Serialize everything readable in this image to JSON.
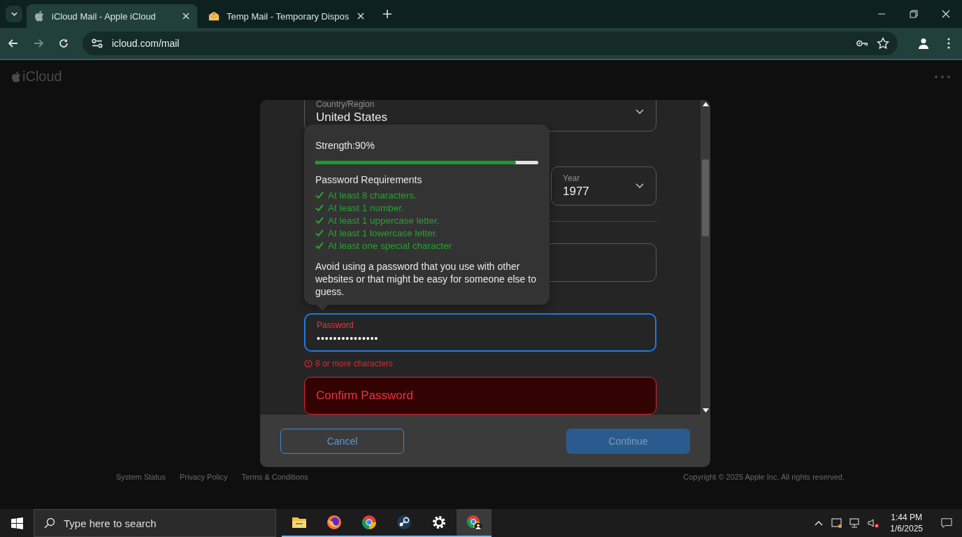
{
  "browser": {
    "tabs": [
      {
        "title": "iCloud Mail - Apple iCloud",
        "selected": true,
        "kind": "apple"
      },
      {
        "title": "Temp Mail - Temporary Dispos",
        "selected": false,
        "kind": "envelope"
      }
    ],
    "url": "icloud.com/mail"
  },
  "page": {
    "logo": "iCloud",
    "footer_links": [
      "System Status",
      "Privacy Policy",
      "Terms & Conditions"
    ],
    "copyright": "Copyright © 2025 Apple Inc. All rights reserved."
  },
  "dialog": {
    "country": {
      "label": "Country/Region",
      "value": "United States"
    },
    "year": {
      "label": "Year",
      "value": "1977"
    },
    "password": {
      "label": "Password",
      "value": "•••••••••••••••",
      "focused": true,
      "error": "8 or more characters"
    },
    "confirm_password": {
      "placeholder": "Confirm Password",
      "invalid": true
    },
    "strength_popup": {
      "strength": "Strength:90%",
      "level": 0.9,
      "heading": "Password Requirements",
      "requirements": [
        {
          "text": "At least 8 characters.",
          "met": true
        },
        {
          "text": "At least 1 number.",
          "met": true
        },
        {
          "text": "At least 1 uppercase letter.",
          "met": true
        },
        {
          "text": "At least 1 lowercase letter.",
          "met": true
        },
        {
          "text": "At least one special character",
          "met": true
        }
      ],
      "advice": "Avoid using a password that you use with other websites or that might be easy for someone else to guess."
    },
    "buttons": [
      {
        "label": "Cancel",
        "kind": "secondary",
        "disabled": false
      },
      {
        "label": "Continue",
        "kind": "primary",
        "disabled": true
      }
    ]
  },
  "taskbar": {
    "search_placeholder": "Type here to search",
    "apps": [
      {
        "kind": "folder",
        "selected": false
      },
      {
        "kind": "firefox",
        "selected": false
      },
      {
        "kind": "chrome",
        "selected": false
      },
      {
        "kind": "steam",
        "selected": false
      },
      {
        "kind": "gear",
        "selected": false
      },
      {
        "kind": "chrome-profile",
        "selected": true
      }
    ],
    "time": "1:44 PM",
    "date": "1/6/2025"
  }
}
